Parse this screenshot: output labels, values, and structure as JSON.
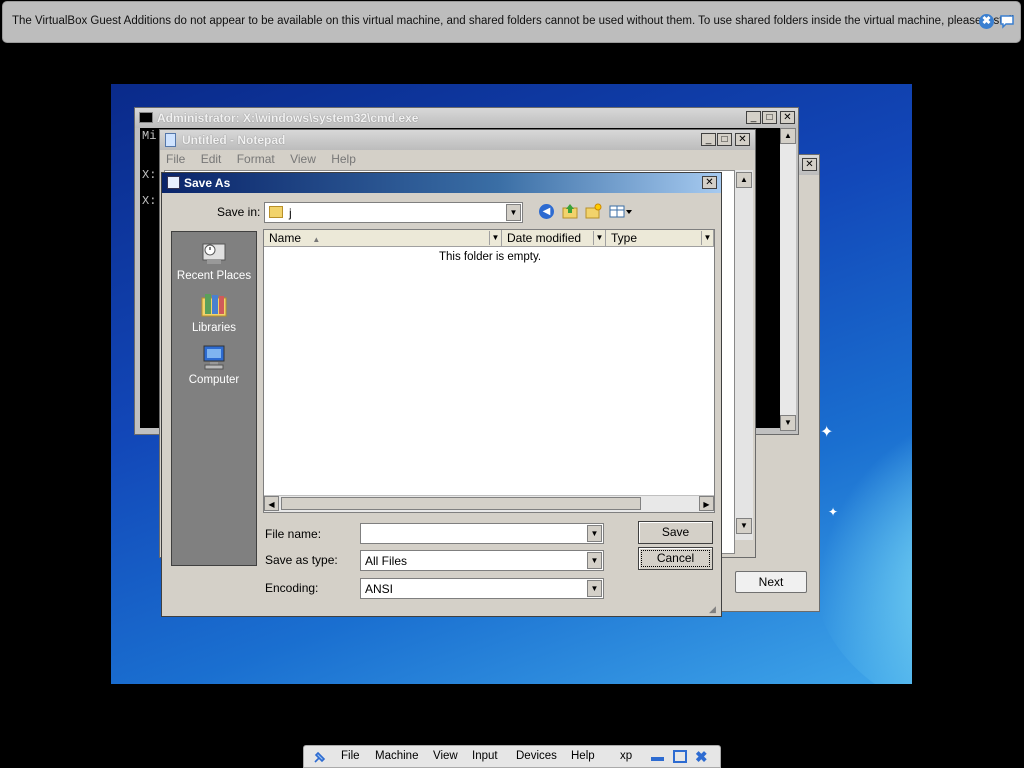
{
  "notification": {
    "text": "The VirtualBox Guest Additions do not appear to be available on this virtual machine, and shared folders cannot be used without them. To use shared folders inside the virtual machine, please install",
    "close_icon": "✖"
  },
  "cmd_window": {
    "title": "Administrator: X:\\windows\\system32\\cmd.exe",
    "lines": [
      "Mi",
      "",
      "X:",
      "",
      "X:"
    ]
  },
  "setup_window": {
    "next_label": "Next"
  },
  "notepad": {
    "title": "Untitled - Notepad",
    "menu": [
      "File",
      "Edit",
      "Format",
      "View",
      "Help"
    ]
  },
  "save_as": {
    "title": "Save As",
    "save_in_label": "Save in:",
    "save_in_value": "j",
    "places": [
      "Recent Places",
      "Libraries",
      "Computer"
    ],
    "columns": [
      "Name",
      "Date modified",
      "Type"
    ],
    "empty_message": "This folder is empty.",
    "file_name_label": "File name:",
    "file_name_value": "",
    "save_as_type_label": "Save as type:",
    "save_as_type_value": "All Files",
    "encoding_label": "Encoding:",
    "encoding_value": "ANSI",
    "save_button": "Save",
    "cancel_button": "Cancel"
  },
  "vbox_bar": {
    "menus": [
      "File",
      "Machine",
      "View",
      "Input",
      "Devices",
      "Help"
    ],
    "vm_name": "xp"
  },
  "colors": {
    "active_title": "#0a246a",
    "dialog_bg": "#d4d0c8",
    "desktop_blue": "#1247b8"
  }
}
